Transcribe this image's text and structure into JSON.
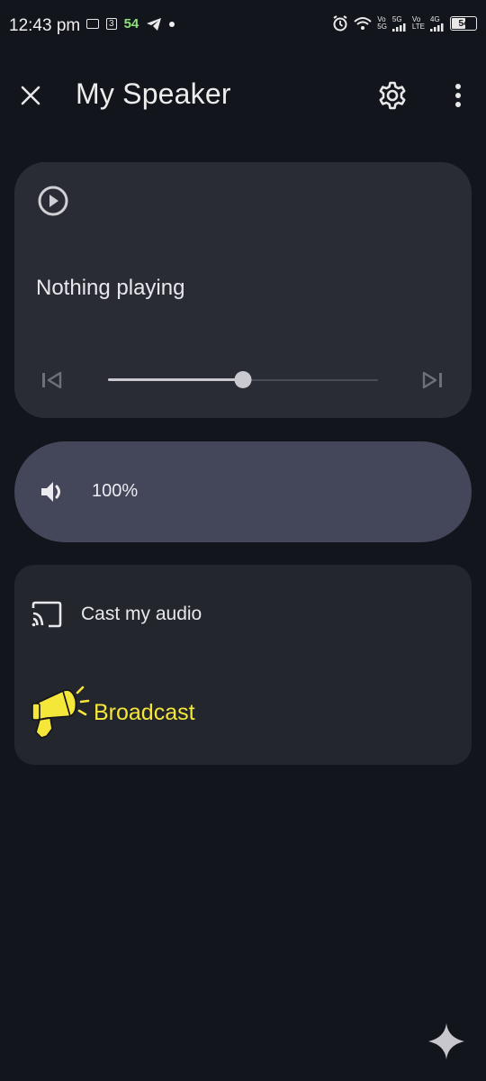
{
  "status_bar": {
    "time": "12:43 pm",
    "notification_count": "54",
    "mini_badge": "3",
    "network_labels": [
      "Vo",
      "5G",
      "5G",
      "Vo",
      "LTE",
      "4G"
    ],
    "battery": "54"
  },
  "header": {
    "title": "My Speaker"
  },
  "media": {
    "status": "Nothing playing",
    "progress_percent": 50
  },
  "volume": {
    "value": "100%"
  },
  "actions": {
    "cast_label": "Cast my audio",
    "broadcast_label": "Broadcast"
  },
  "icons": {
    "close": "close-icon",
    "settings": "gear-icon",
    "more": "more-vert-icon",
    "play": "play-circle-icon",
    "previous": "skip-previous-icon",
    "next": "skip-next-icon",
    "volume": "volume-icon",
    "cast": "cast-icon",
    "broadcast": "megaphone-icon",
    "assistant": "sparkle-icon"
  },
  "colors": {
    "background": "#13151c",
    "card": "#2a2c35",
    "volume_pill": "#444659",
    "broadcast_accent": "#f5e63a",
    "notification_accent": "#8ee07a"
  }
}
